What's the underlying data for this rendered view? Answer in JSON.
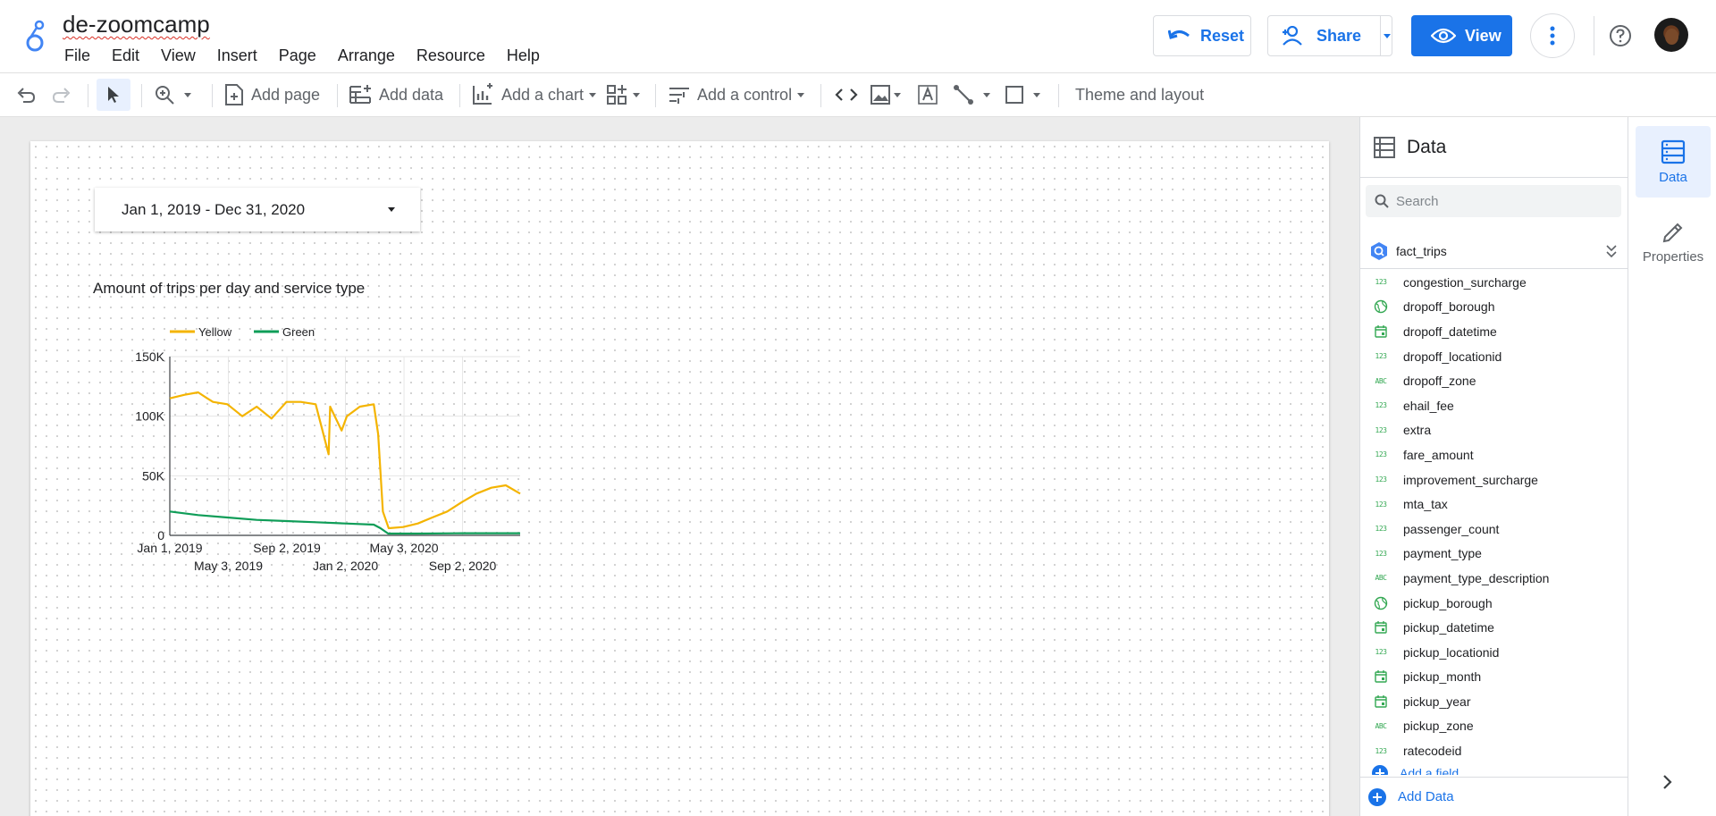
{
  "app": {
    "title": "de-zoomcamp",
    "menu": [
      "File",
      "Edit",
      "View",
      "Insert",
      "Page",
      "Arrange",
      "Resource",
      "Help"
    ],
    "buttons": {
      "reset": "Reset",
      "share": "Share",
      "view": "View"
    }
  },
  "toolbar": {
    "add_page": "Add page",
    "add_data": "Add data",
    "add_chart": "Add a chart",
    "add_control": "Add a control",
    "theme": "Theme and layout"
  },
  "canvas": {
    "date_range": "Jan 1, 2019 - Dec 31, 2020",
    "chart_title": "Amount of trips per day and service type"
  },
  "chart_data": {
    "type": "line",
    "title": "Amount of trips per day and service type",
    "legend": [
      "Yellow",
      "Green"
    ],
    "legend_position": "top-left",
    "y_ticks": [
      "150K",
      "100K",
      "50K",
      "0"
    ],
    "ylim": [
      0,
      150000
    ],
    "x_ticks_row1": [
      "Jan 1, 2019",
      "Sep 2, 2019",
      "May 3, 2020"
    ],
    "x_ticks_row2": [
      "May 3, 2019",
      "Jan 2, 2020",
      "Sep 2, 2020"
    ],
    "x_range": [
      "2019-01-01",
      "2020-12-31"
    ],
    "series": [
      {
        "name": "Yellow",
        "color": "#f4b400",
        "x": [
          "2019-01-01",
          "2019-02-01",
          "2019-03-01",
          "2019-03-20",
          "2019-04-01",
          "2019-05-01",
          "2019-06-01",
          "2019-07-01",
          "2019-08-01",
          "2019-09-01",
          "2019-10-01",
          "2019-11-01",
          "2019-11-28",
          "2019-12-01",
          "2019-12-25",
          "2020-01-05",
          "2020-02-01",
          "2020-03-01",
          "2020-03-10",
          "2020-03-20",
          "2020-04-01",
          "2020-05-01",
          "2020-06-01",
          "2020-07-01",
          "2020-08-01",
          "2020-09-01",
          "2020-10-01",
          "2020-11-01",
          "2020-12-01",
          "2020-12-31"
        ],
        "values": [
          115000,
          118000,
          120000,
          115000,
          112000,
          110000,
          100000,
          108000,
          98000,
          112000,
          112000,
          110000,
          68000,
          108000,
          88000,
          100000,
          108000,
          110000,
          85000,
          20000,
          6000,
          7000,
          10000,
          15000,
          20000,
          28000,
          35000,
          40000,
          42000,
          35000
        ]
      },
      {
        "name": "Green",
        "color": "#0f9d58",
        "x": [
          "2019-01-01",
          "2019-03-01",
          "2019-05-01",
          "2019-07-01",
          "2019-09-01",
          "2019-11-01",
          "2020-01-01",
          "2020-03-01",
          "2020-03-15",
          "2020-03-31",
          "2020-06-01",
          "2020-09-01",
          "2020-12-31"
        ],
        "values": [
          20000,
          17000,
          15000,
          13000,
          12000,
          11000,
          10000,
          9000,
          6000,
          1500,
          1500,
          1800,
          1800
        ]
      }
    ]
  },
  "data_panel": {
    "title": "Data",
    "search_placeholder": "Search",
    "source": "fact_trips",
    "fields": [
      {
        "name": "congestion_surcharge",
        "type": "123"
      },
      {
        "name": "dropoff_borough",
        "type": "geo"
      },
      {
        "name": "dropoff_datetime",
        "type": "date"
      },
      {
        "name": "dropoff_locationid",
        "type": "123"
      },
      {
        "name": "dropoff_zone",
        "type": "ABC"
      },
      {
        "name": "ehail_fee",
        "type": "123"
      },
      {
        "name": "extra",
        "type": "123"
      },
      {
        "name": "fare_amount",
        "type": "123"
      },
      {
        "name": "improvement_surcharge",
        "type": "123"
      },
      {
        "name": "mta_tax",
        "type": "123"
      },
      {
        "name": "passenger_count",
        "type": "123"
      },
      {
        "name": "payment_type",
        "type": "123"
      },
      {
        "name": "payment_type_description",
        "type": "ABC"
      },
      {
        "name": "pickup_borough",
        "type": "geo"
      },
      {
        "name": "pickup_datetime",
        "type": "date"
      },
      {
        "name": "pickup_locationid",
        "type": "123"
      },
      {
        "name": "pickup_month",
        "type": "date"
      },
      {
        "name": "pickup_year",
        "type": "date"
      },
      {
        "name": "pickup_zone",
        "type": "ABC"
      },
      {
        "name": "ratecodeid",
        "type": "123"
      }
    ],
    "add_field": "Add a field",
    "add_data": "Add Data"
  },
  "right_rail": {
    "data": "Data",
    "properties": "Properties"
  },
  "colors": {
    "accent": "#1a73e8",
    "yellow": "#f4b400",
    "green": "#0f9d58"
  }
}
